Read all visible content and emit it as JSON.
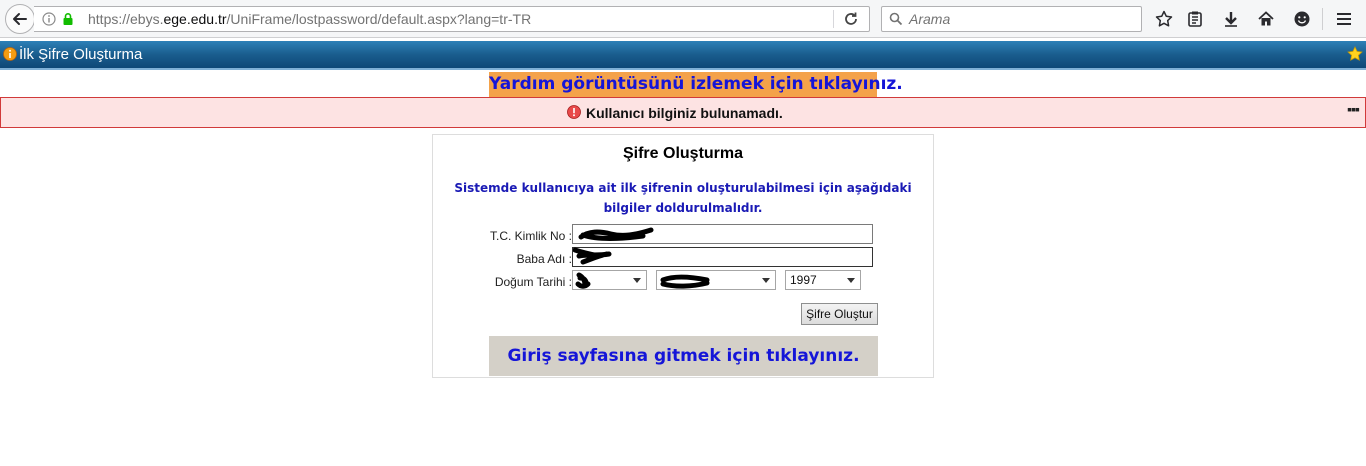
{
  "browser": {
    "url_prefix": "https://ebys.",
    "url_host": "ege.edu.tr",
    "url_path": "/UniFrame/lostpassword/default.aspx?lang=tr-TR",
    "search_placeholder": "Arama"
  },
  "header": {
    "title": "İlk Şifre Oluşturma"
  },
  "help": {
    "link_text": "Yardım görüntüsünü izlemek için tıklayınız."
  },
  "error": {
    "message": "Kullanıcı bilginiz bulunamadı.",
    "dots": "▪▪▪"
  },
  "form": {
    "title": "Şifre Oluşturma",
    "description": "Sistemde kullanıcıya ait ilk şifrenin oluşturulabilmesi için aşağıdaki bilgiler doldurulmalıdır.",
    "tc_label": "T.C. Kimlik No :",
    "father_label": "Baba Adı :",
    "birth_label": "Doğum Tarihi :",
    "year_value": "1997",
    "submit_label": "Şifre Oluştur",
    "login_link": "Giriş sayfasına gitmek için tıklayınız."
  },
  "colors": {
    "help_bg": "#f4a24a",
    "link_blue": "#1515d8",
    "error_bg": "#fde3e3",
    "error_border": "#d13a3a",
    "header_blue": "#1a5d8e"
  }
}
